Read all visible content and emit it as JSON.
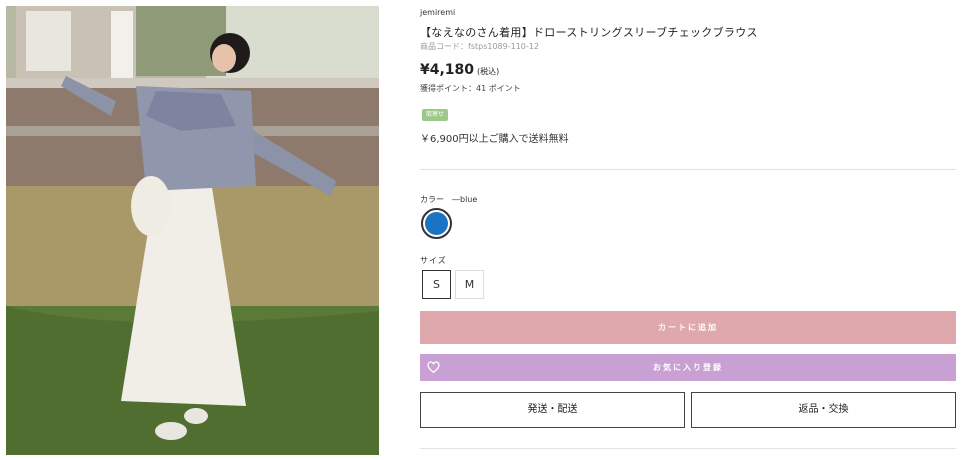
{
  "product": {
    "brand": "jemiremi",
    "title": "【なえなのさん着用】ドローストリングスリーブチェックブラウス",
    "code": "商品コード：fstps1089-110-12",
    "price": "¥4,180",
    "tax_note": "(税込)",
    "points": "獲得ポイント：41 ポイント",
    "badge": "取寄せ",
    "shipping_note": "￥6,900円以上ご購入で送料無料"
  },
  "options": {
    "color_label": "カラー　―blue",
    "color_swatch": "#1a74c3",
    "size_label": "サイズ",
    "sizes": [
      "S",
      "M"
    ],
    "selected_size": "S"
  },
  "actions": {
    "add_to_cart": "カートに追加",
    "add_to_favorites": "お気に入り登録",
    "shipping_link": "発送・配送",
    "returns_link": "返品・交換"
  },
  "colors": {
    "cart_button": "#dfa8ad",
    "favorite_button": "#c8a0d3",
    "badge": "#9cc98a"
  },
  "icons": {
    "favorite": "heart-icon"
  }
}
